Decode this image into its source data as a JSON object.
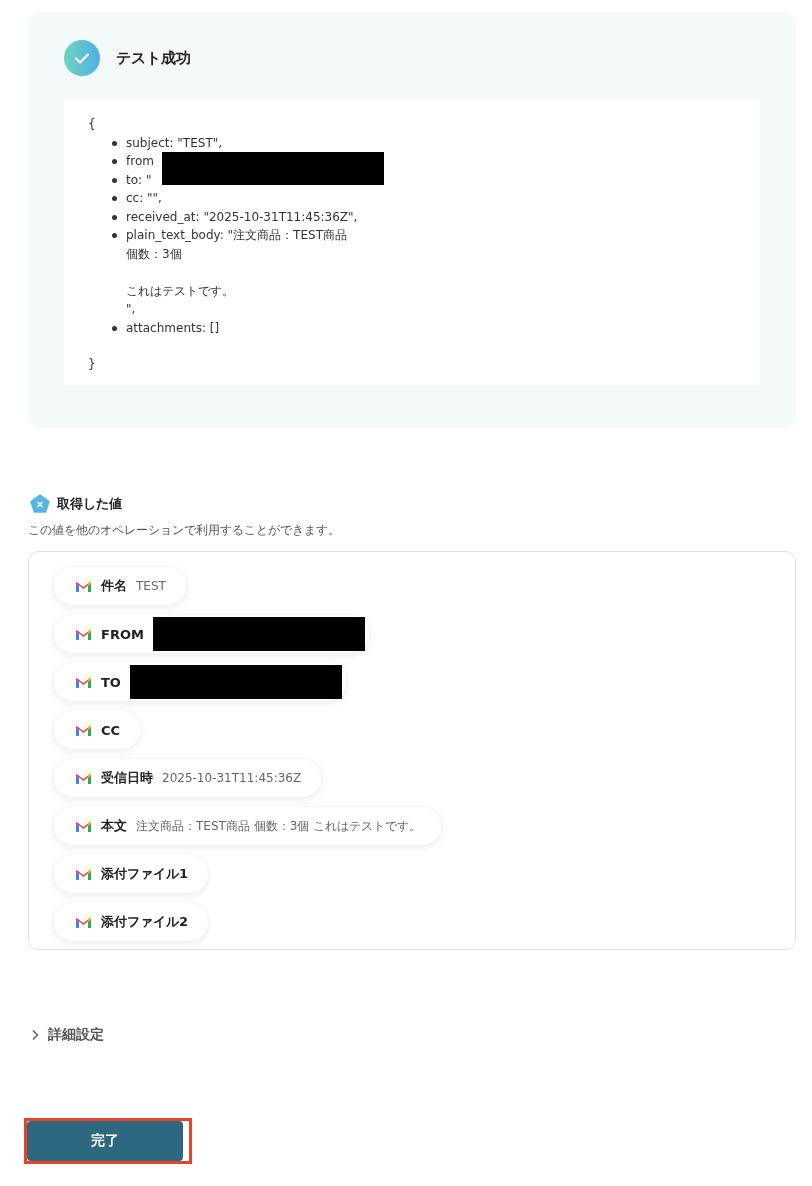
{
  "test_result": {
    "title": "テスト成功",
    "success": true,
    "open_brace": "{",
    "close_brace": "}",
    "lines": [
      {
        "text": "subject: \"TEST\",",
        "redacted": false
      },
      {
        "text": "from",
        "redacted": true
      },
      {
        "text": "to: \"",
        "redacted": false
      },
      {
        "text": "cc: \"\",",
        "redacted": false
      },
      {
        "text": "received_at: \"2025-10-31T11:45:36Z\",",
        "redacted": false
      },
      {
        "paragraphs": [
          [
            "plain_text_body: \"注文商品：TEST商品",
            "個数：3個"
          ],
          [
            "これはテストです。",
            "\","
          ]
        ],
        "redacted": false
      },
      {
        "text": "attachments: []",
        "redacted": false
      }
    ]
  },
  "values_section": {
    "title": "取得した値",
    "description": "この値を他のオペレーションで利用することができます。",
    "chips": [
      {
        "label": "件名",
        "value": "TEST",
        "redacted": false
      },
      {
        "label": "FROM",
        "redacted": true
      },
      {
        "label": "TO",
        "redacted": true
      },
      {
        "label": "CC",
        "redacted": false
      },
      {
        "label": "受信日時",
        "value": "2025-10-31T11:45:36Z",
        "redacted": false
      },
      {
        "label": "本文",
        "value": "注文商品：TEST商品 個数：3個 これはテストです。",
        "redacted": false
      },
      {
        "label": "添付ファイル1",
        "redacted": false
      },
      {
        "label": "添付ファイル2",
        "redacted": false
      }
    ]
  },
  "advanced": {
    "label": "詳細設定",
    "expanded": false
  },
  "done_button": {
    "label": "完了",
    "highlighted": true
  }
}
